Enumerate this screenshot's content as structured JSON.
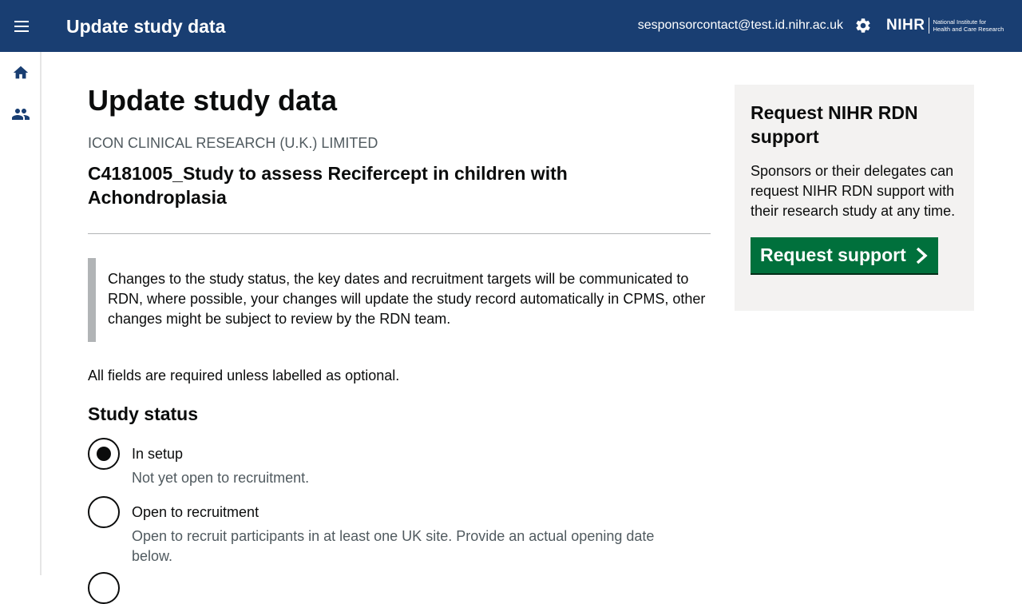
{
  "header": {
    "title": "Update study data",
    "user_email": "sesponsorcontact@test.id.nihr.ac.uk",
    "logo_main": "NIHR",
    "logo_sub_line1": "National Institute for",
    "logo_sub_line2": "Health and Care Research",
    "icons": [
      "menu-icon",
      "gear-icon"
    ],
    "background_color": "#193e72"
  },
  "sidebar": {
    "items": [
      {
        "icon": "home-icon"
      },
      {
        "icon": "people-icon"
      }
    ]
  },
  "main": {
    "title": "Update study data",
    "organisation": "ICON CLINICAL RESEARCH (U.K.) LIMITED",
    "study_title": "C4181005_Study to assess Recifercept in children with Achondroplasia",
    "inset_text": "Changes to the study status, the key dates and recruitment targets will be communicated to RDN, where possible, your changes will update the study record automatically in CPMS, other changes might be subject to review by the RDN team.",
    "required_note": "All fields are required unless labelled as optional.",
    "study_status": {
      "heading": "Study status",
      "options": [
        {
          "label": "In setup",
          "hint": "Not yet open to recruitment.",
          "selected": true
        },
        {
          "label": "Open to recruitment",
          "hint": "Open to recruit participants in at least one UK site. Provide an actual opening date below.",
          "selected": false
        }
      ]
    }
  },
  "support_panel": {
    "title": "Request NIHR RDN support",
    "body": "Sponsors or their delegates can request NIHR RDN support with their research study at any time.",
    "button_label": "Request support",
    "button_color": "#00703c",
    "background_color": "#f3f2f1"
  }
}
